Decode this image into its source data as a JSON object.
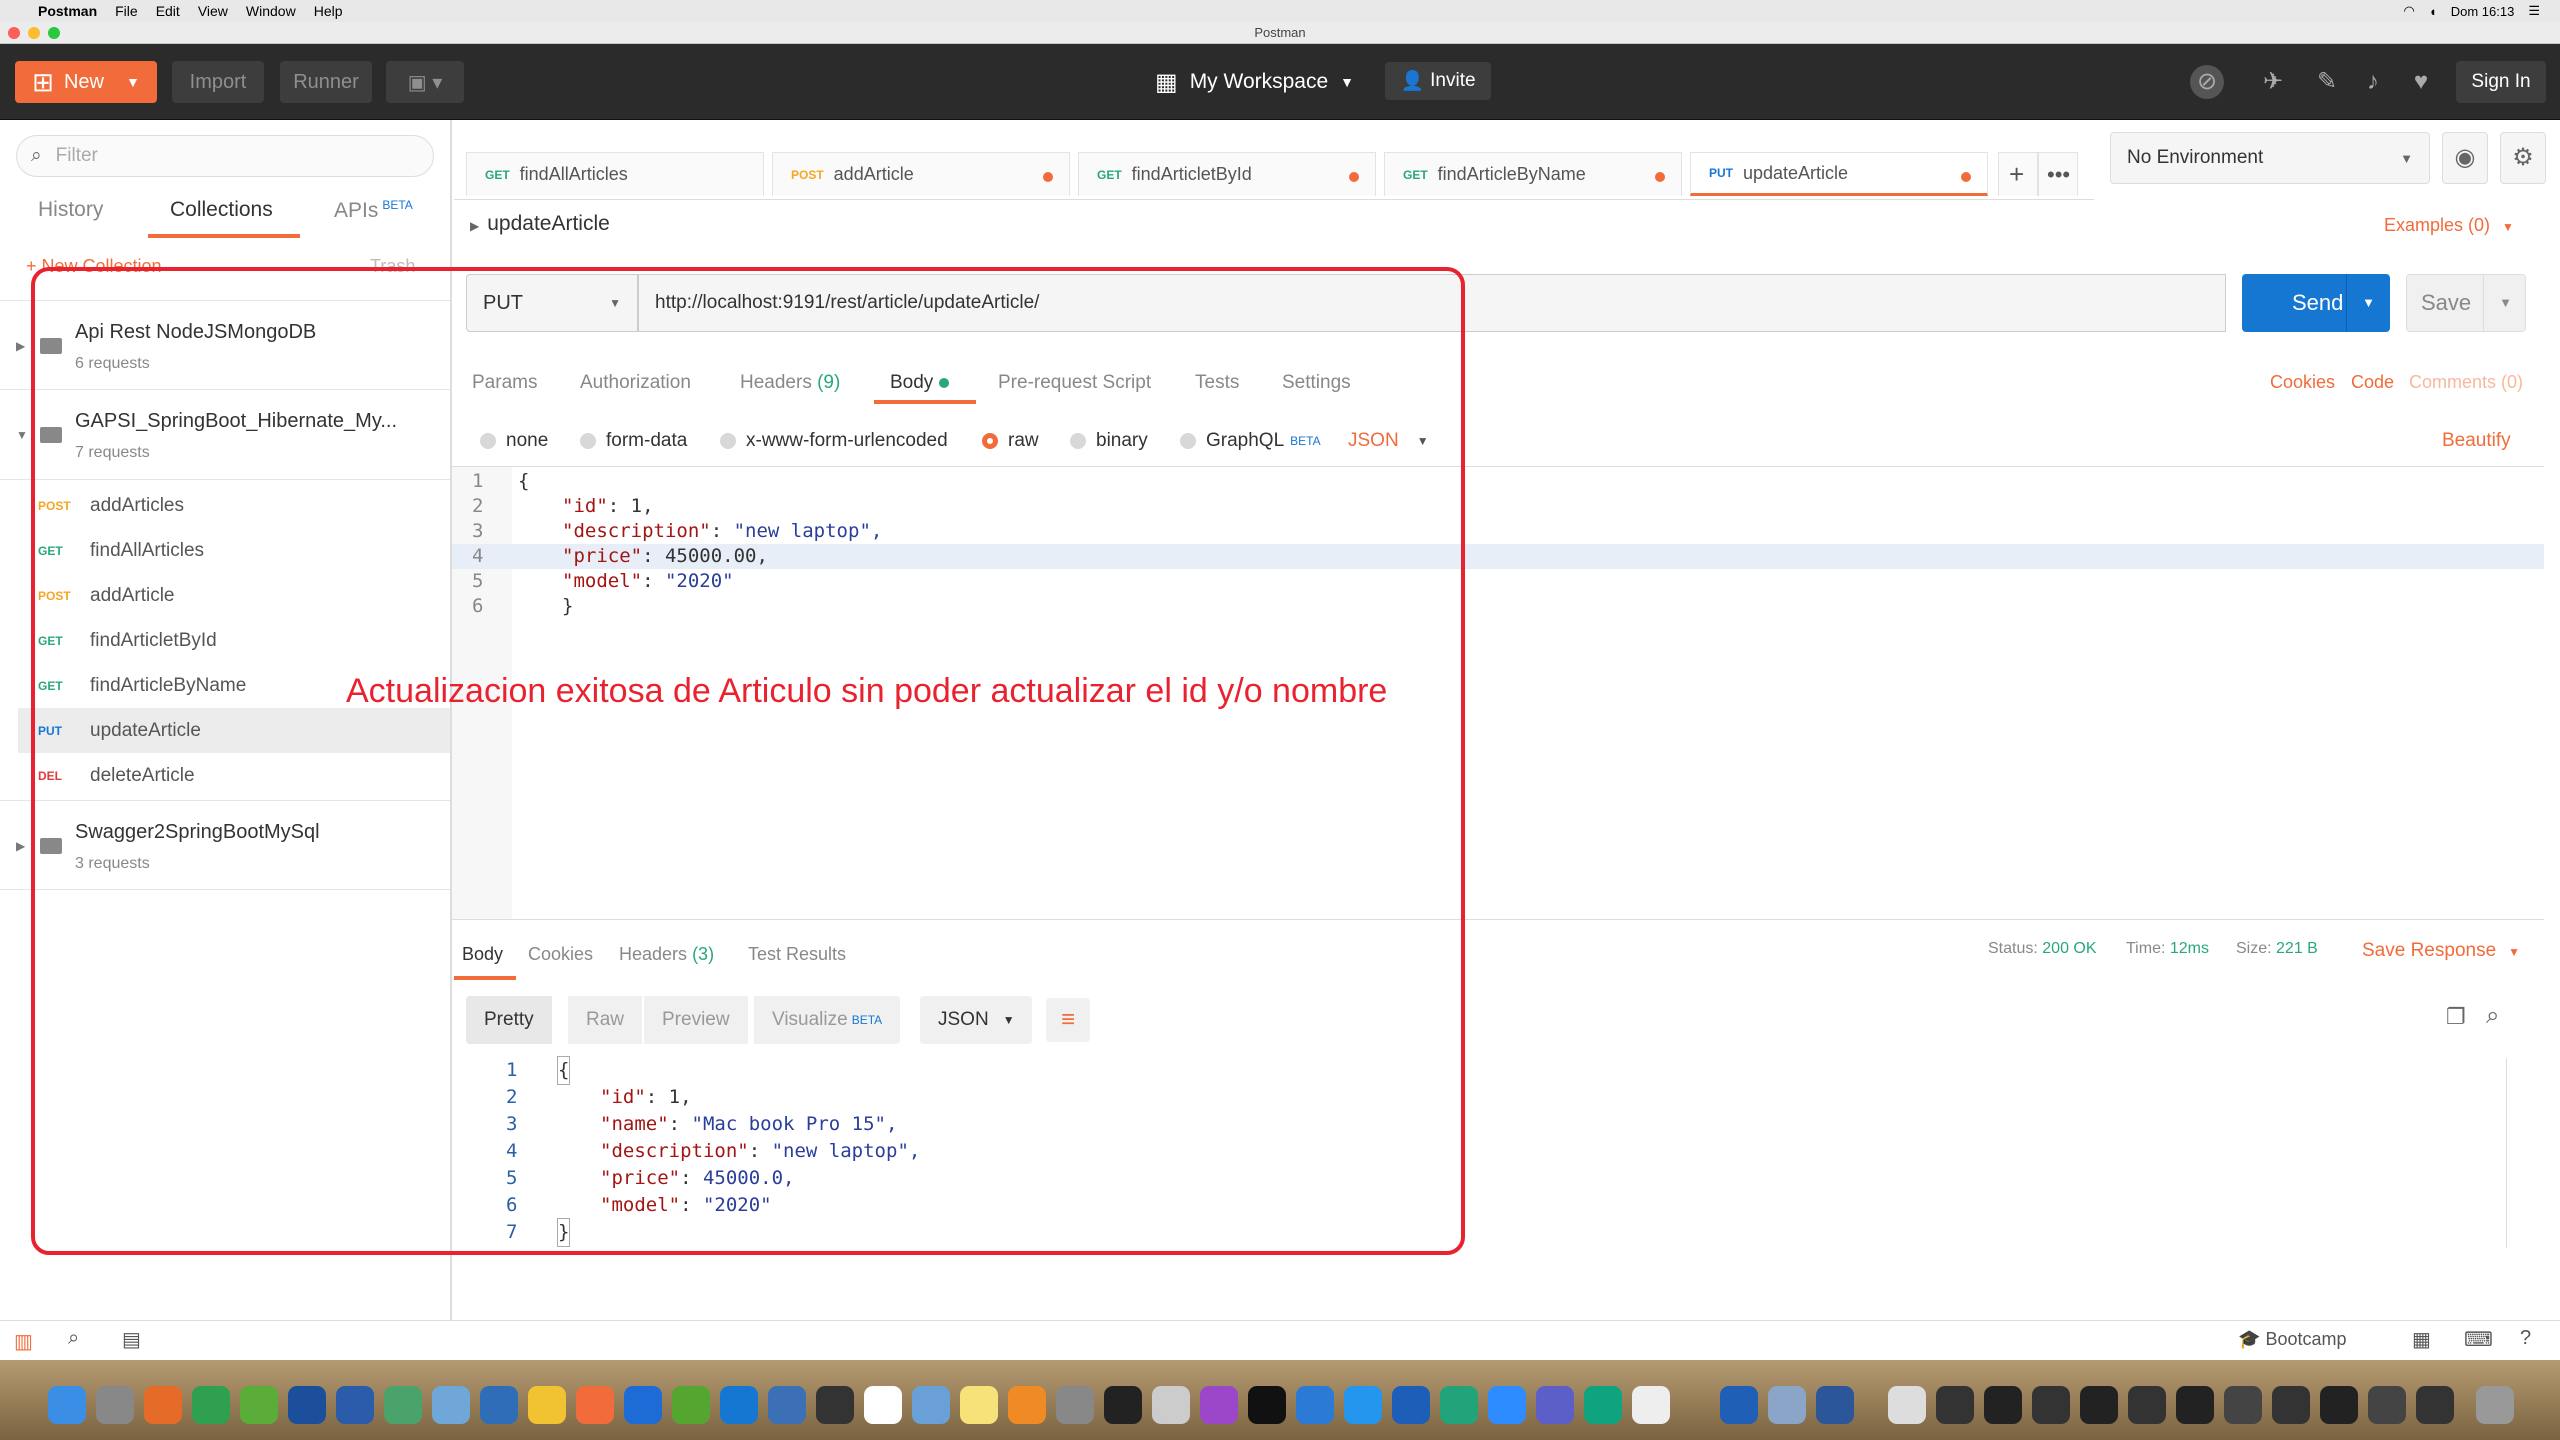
{
  "menubar": {
    "apple": "",
    "app": "Postman",
    "items": [
      "File",
      "Edit",
      "View",
      "Window",
      "Help"
    ],
    "clock": "Dom 16:13"
  },
  "window": {
    "title": "Postman"
  },
  "header": {
    "new_label": "New",
    "import_label": "Import",
    "runner_label": "Runner",
    "workspace_label": "My Workspace",
    "invite_label": "Invite",
    "signin_label": "Sign In"
  },
  "sidebar": {
    "filter_placeholder": "Filter",
    "tabs": {
      "history": "History",
      "collections": "Collections",
      "apis": "APIs",
      "apis_badge": "BETA"
    },
    "new_collection": "+ New Collection",
    "trash": "Trash",
    "collections": [
      {
        "name": "Api Rest NodeJSMongoDB",
        "count": "6 requests"
      },
      {
        "name": "GAPSI_SpringBoot_Hibernate_My...",
        "count": "7 requests"
      },
      {
        "name": "Swagger2SpringBootMySql",
        "count": "3 requests"
      }
    ],
    "requests": [
      {
        "method": "POST",
        "name": "addArticles"
      },
      {
        "method": "GET",
        "name": "findAllArticles"
      },
      {
        "method": "POST",
        "name": "addArticle"
      },
      {
        "method": "GET",
        "name": "findArticletById"
      },
      {
        "method": "GET",
        "name": "findArticleByName"
      },
      {
        "method": "PUT",
        "name": "updateArticle"
      },
      {
        "method": "DEL",
        "name": "deleteArticle"
      }
    ]
  },
  "tabs": [
    {
      "method": "GET",
      "name": "findAllArticles"
    },
    {
      "method": "POST",
      "name": "addArticle"
    },
    {
      "method": "GET",
      "name": "findArticletById"
    },
    {
      "method": "GET",
      "name": "findArticleByName"
    },
    {
      "method": "PUT",
      "name": "updateArticle"
    }
  ],
  "environment": "No Environment",
  "request": {
    "name": "updateArticle",
    "examples": "Examples (0)",
    "method": "PUT",
    "url": "http://localhost:9191/rest/article/updateArticle/",
    "send": "Send",
    "save": "Save",
    "subtabs": {
      "params": "Params",
      "auth": "Authorization",
      "headers": "Headers",
      "headers_count": "(9)",
      "body": "Body",
      "prereq": "Pre-request Script",
      "tests": "Tests",
      "settings": "Settings"
    },
    "links": {
      "cookies": "Cookies",
      "code": "Code",
      "comments": "Comments (0)"
    },
    "body_types": {
      "none": "none",
      "formdata": "form-data",
      "urlenc": "x-www-form-urlencoded",
      "raw": "raw",
      "binary": "binary",
      "graphql": "GraphQL",
      "graphql_badge": "BETA",
      "lang": "JSON",
      "beautify": "Beautify"
    },
    "body_lines": [
      {
        "n": "1",
        "t": "{"
      },
      {
        "n": "2",
        "k": "\"id\"",
        "v": " 1,"
      },
      {
        "n": "3",
        "k": "\"description\"",
        "v": " \"new laptop\","
      },
      {
        "n": "4",
        "k": "\"price\"",
        "v": " 45000.00,"
      },
      {
        "n": "5",
        "k": "\"model\"",
        "v": " \"2020\""
      },
      {
        "n": "6",
        "t": "}"
      }
    ]
  },
  "response": {
    "tabs": {
      "body": "Body",
      "cookies": "Cookies",
      "headers": "Headers",
      "headers_count": "(3)",
      "tests": "Test Results"
    },
    "status_label": "Status:",
    "status": "200 OK",
    "time_label": "Time:",
    "time": "12ms",
    "size_label": "Size:",
    "size": "221 B",
    "save": "Save Response",
    "views": {
      "pretty": "Pretty",
      "raw": "Raw",
      "preview": "Preview",
      "visualize": "Visualize",
      "visualize_badge": "BETA",
      "lang": "JSON"
    },
    "lines": [
      {
        "n": "1",
        "t": "{"
      },
      {
        "n": "2",
        "k": "\"id\"",
        "v": " 1,"
      },
      {
        "n": "3",
        "k": "\"name\"",
        "v": " \"Mac book Pro 15\","
      },
      {
        "n": "4",
        "k": "\"description\"",
        "v": " \"new laptop\","
      },
      {
        "n": "5",
        "k": "\"price\"",
        "v": " 45000.0,"
      },
      {
        "n": "6",
        "k": "\"model\"",
        "v": " \"2020\""
      },
      {
        "n": "7",
        "t": "}"
      }
    ]
  },
  "annotation": "Actualizacion exitosa de Articulo sin poder actualizar el id y/o nombre",
  "footer": {
    "bootcamp": "Bootcamp"
  },
  "colors": {
    "accent": "#f26b3a",
    "send": "#1677d2",
    "annotation": "#e8232f",
    "get": "#2aa87a",
    "post": "#f5a623",
    "put": "#1677d2",
    "del": "#e03b3b"
  }
}
